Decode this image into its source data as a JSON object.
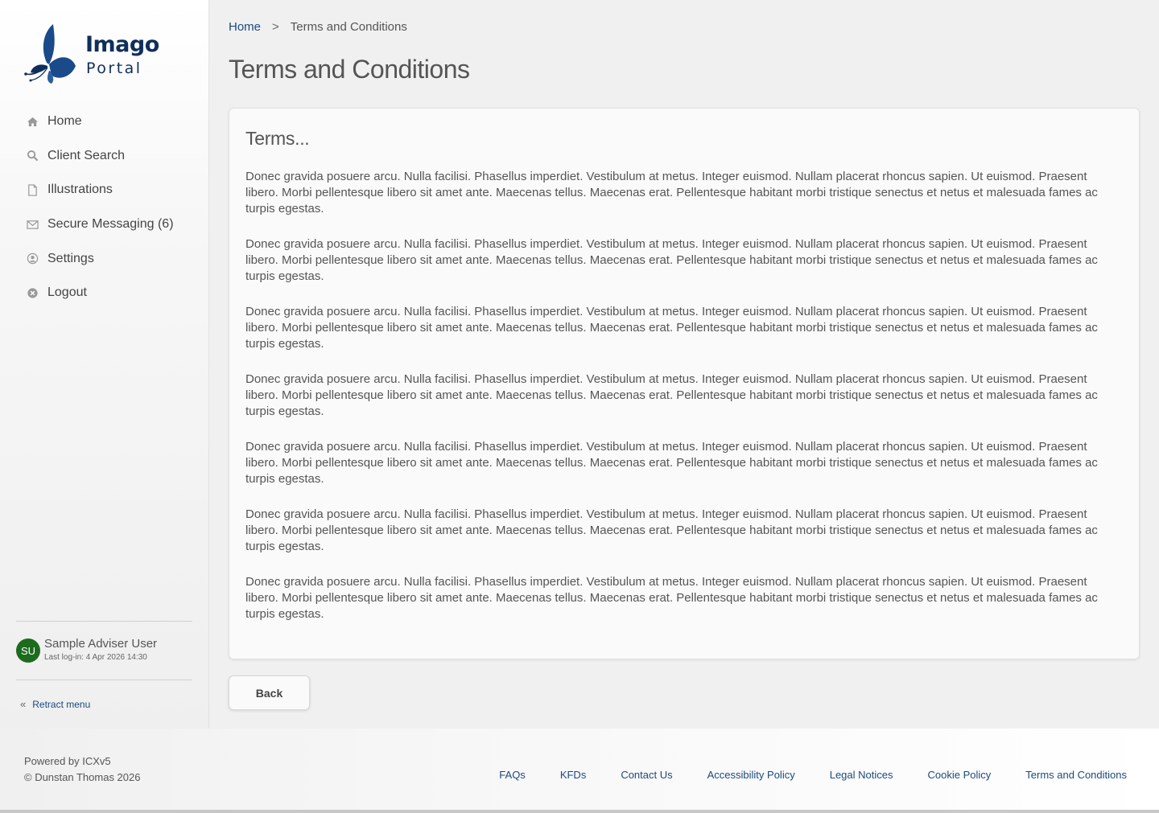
{
  "brand": {
    "name_line1": "Imago",
    "name_line2": "Portal",
    "color": "#0f2f5a",
    "link_color": "#1a4a80"
  },
  "sidebar": {
    "items": [
      {
        "label": "Home",
        "icon": "home-icon"
      },
      {
        "label": "Client Search",
        "icon": "search-icon"
      },
      {
        "label": "Illustrations",
        "icon": "document-icon"
      },
      {
        "label": "Secure Messaging (6)",
        "icon": "envelope-icon"
      },
      {
        "label": "Settings",
        "icon": "user-circle-icon"
      },
      {
        "label": "Logout",
        "icon": "close-circle-icon"
      }
    ],
    "user": {
      "initials": "SU",
      "name": "Sample Adviser User",
      "last_login": "Last log-in: 4 Apr 2026 14:30",
      "avatar_color": "#1d6b1d"
    },
    "retract_label": "Retract menu"
  },
  "breadcrumb": {
    "home": "Home",
    "separator": ">",
    "current": "Terms and Conditions"
  },
  "page": {
    "title": "Terms and Conditions",
    "card_title": "Terms...",
    "paragraphs": [
      "Donec gravida posuere arcu. Nulla facilisi. Phasellus imperdiet. Vestibulum at metus. Integer euismod. Nullam placerat rhoncus sapien. Ut euismod. Praesent libero. Morbi pellentesque libero sit amet ante. Maecenas tellus. Maecenas erat. Pellentesque habitant morbi tristique senectus et netus et malesuada fames ac turpis egestas.",
      "Donec gravida posuere arcu. Nulla facilisi. Phasellus imperdiet. Vestibulum at metus. Integer euismod. Nullam placerat rhoncus sapien. Ut euismod. Praesent libero. Morbi pellentesque libero sit amet ante. Maecenas tellus. Maecenas erat. Pellentesque habitant morbi tristique senectus et netus et malesuada fames ac turpis egestas.",
      "Donec gravida posuere arcu. Nulla facilisi. Phasellus imperdiet. Vestibulum at metus. Integer euismod. Nullam placerat rhoncus sapien. Ut euismod. Praesent libero. Morbi pellentesque libero sit amet ante. Maecenas tellus. Maecenas erat. Pellentesque habitant morbi tristique senectus et netus et malesuada fames ac turpis egestas.",
      "Donec gravida posuere arcu. Nulla facilisi. Phasellus imperdiet. Vestibulum at metus. Integer euismod. Nullam placerat rhoncus sapien. Ut euismod. Praesent libero. Morbi pellentesque libero sit amet ante. Maecenas tellus. Maecenas erat. Pellentesque habitant morbi tristique senectus et netus et malesuada fames ac turpis egestas.",
      "Donec gravida posuere arcu. Nulla facilisi. Phasellus imperdiet. Vestibulum at metus. Integer euismod. Nullam placerat rhoncus sapien. Ut euismod. Praesent libero. Morbi pellentesque libero sit amet ante. Maecenas tellus. Maecenas erat. Pellentesque habitant morbi tristique senectus et netus et malesuada fames ac turpis egestas.",
      "Donec gravida posuere arcu. Nulla facilisi. Phasellus imperdiet. Vestibulum at metus. Integer euismod. Nullam placerat rhoncus sapien. Ut euismod. Praesent libero. Morbi pellentesque libero sit amet ante. Maecenas tellus. Maecenas erat. Pellentesque habitant morbi tristique senectus et netus et malesuada fames ac turpis egestas.",
      "Donec gravida posuere arcu. Nulla facilisi. Phasellus imperdiet. Vestibulum at metus. Integer euismod. Nullam placerat rhoncus sapien. Ut euismod. Praesent libero. Morbi pellentesque libero sit amet ante. Maecenas tellus. Maecenas erat. Pellentesque habitant morbi tristique senectus et netus et malesuada fames ac turpis egestas."
    ],
    "back_label": "Back"
  },
  "footer": {
    "powered_by": "Powered by ICXv5",
    "copyright": "© Dunstan Thomas 2026",
    "links": [
      "FAQs",
      "KFDs",
      "Contact Us",
      "Accessibility Policy",
      "Legal Notices",
      "Cookie Policy",
      "Terms and Conditions"
    ]
  }
}
